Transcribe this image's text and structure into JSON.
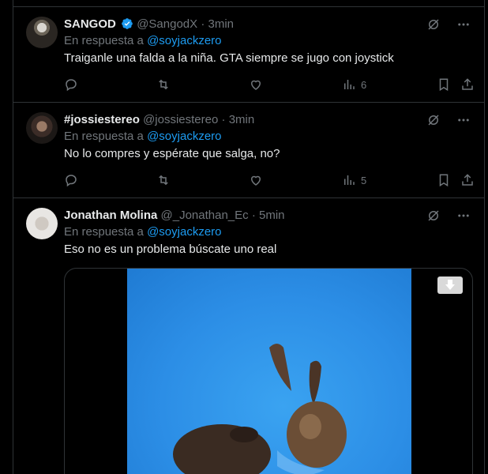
{
  "tweets": [
    {
      "name": "SANGOD",
      "verified": true,
      "handle": "@SangodX",
      "time": "3min",
      "reply_prefix": "En respuesta a",
      "reply_mention": "@soyjackzero",
      "text": "Traiganle una falda a la niña. GTA siempre se jugo con joystick",
      "views": "6"
    },
    {
      "name": "#jossiestereo",
      "verified": false,
      "handle": "@jossiestereo",
      "time": "3min",
      "reply_prefix": "En respuesta a",
      "reply_mention": "@soyjackzero",
      "text": "No lo compres y espérate que salga, no?",
      "views": "5"
    },
    {
      "name": "Jonathan Molina",
      "verified": false,
      "handle": "@_Jonathan_Ec",
      "time": "5min",
      "reply_prefix": "En respuesta a",
      "reply_mention": "@soyjackzero",
      "text": "Eso no es un problema búscate uno real"
    }
  ],
  "separator": "·",
  "colors": {
    "background": "#000000",
    "text": "#e7e9ea",
    "secondary": "#71767b",
    "accent": "#1d9bf0",
    "border": "#2f3336"
  },
  "icons": [
    "reply-icon",
    "retweet-icon",
    "like-icon",
    "views-icon",
    "bookmark-icon",
    "share-icon",
    "grok-icon",
    "more-icon",
    "verified-badge-icon",
    "download-icon"
  ]
}
